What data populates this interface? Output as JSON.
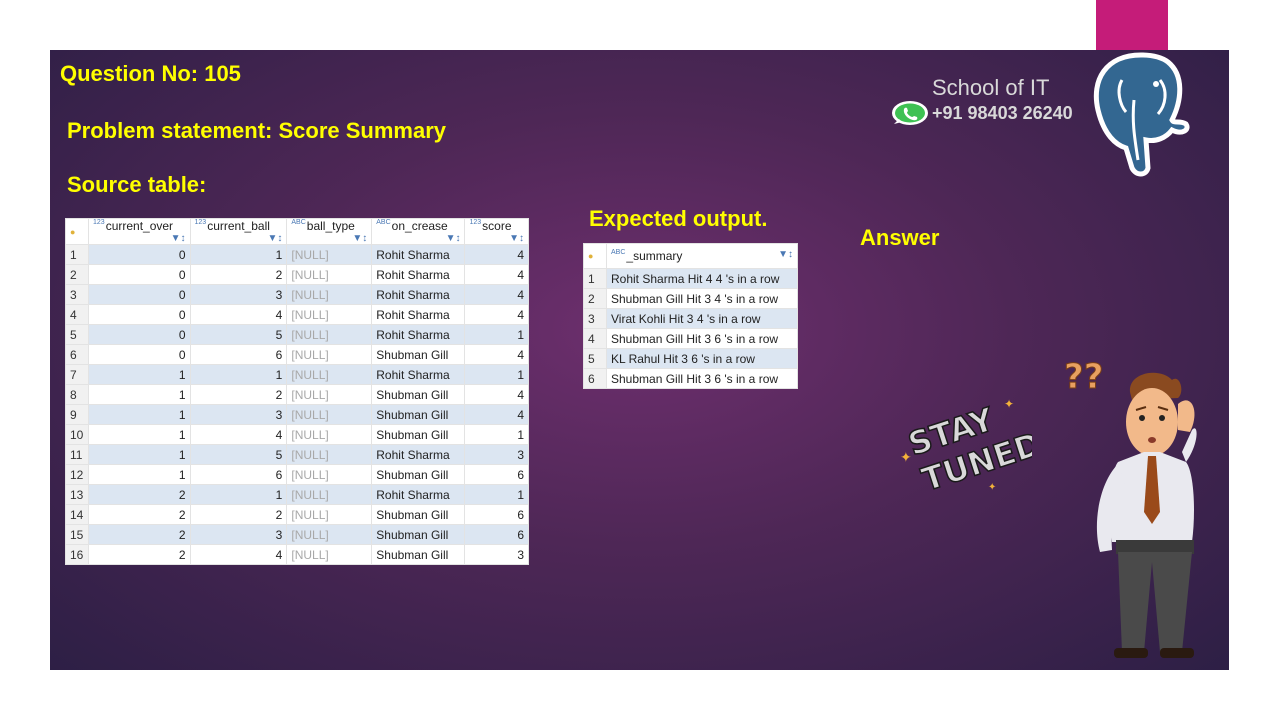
{
  "slide": {
    "question_no": "Question No: 105",
    "problem_statement": "Problem statement: Score Summary",
    "source_table_label": "Source table:",
    "expected_output_label": "Expected output.",
    "answer_label": "Answer"
  },
  "brand": {
    "name": "School of IT",
    "phone": "+91 98403 26240",
    "whatsapp_icon": "whatsapp-icon",
    "logo_icon": "postgresql-elephant-icon"
  },
  "source_table": {
    "columns": [
      {
        "type": "123",
        "name": "current_over"
      },
      {
        "type": "123",
        "name": "current_ball"
      },
      {
        "type": "ABC",
        "name": "ball_type"
      },
      {
        "type": "ABC",
        "name": "on_crease"
      },
      {
        "type": "123",
        "name": "score"
      }
    ],
    "rows": [
      [
        "1",
        "0",
        "1",
        "[NULL]",
        "Rohit Sharma",
        "4"
      ],
      [
        "2",
        "0",
        "2",
        "[NULL]",
        "Rohit Sharma",
        "4"
      ],
      [
        "3",
        "0",
        "3",
        "[NULL]",
        "Rohit Sharma",
        "4"
      ],
      [
        "4",
        "0",
        "4",
        "[NULL]",
        "Rohit Sharma",
        "4"
      ],
      [
        "5",
        "0",
        "5",
        "[NULL]",
        "Rohit Sharma",
        "1"
      ],
      [
        "6",
        "0",
        "6",
        "[NULL]",
        "Shubman Gill",
        "4"
      ],
      [
        "7",
        "1",
        "1",
        "[NULL]",
        "Rohit Sharma",
        "1"
      ],
      [
        "8",
        "1",
        "2",
        "[NULL]",
        "Shubman Gill",
        "4"
      ],
      [
        "9",
        "1",
        "3",
        "[NULL]",
        "Shubman Gill",
        "4"
      ],
      [
        "10",
        "1",
        "4",
        "[NULL]",
        "Shubman Gill",
        "1"
      ],
      [
        "11",
        "1",
        "5",
        "[NULL]",
        "Rohit Sharma",
        "3"
      ],
      [
        "12",
        "1",
        "6",
        "[NULL]",
        "Shubman Gill",
        "6"
      ],
      [
        "13",
        "2",
        "1",
        "[NULL]",
        "Rohit Sharma",
        "1"
      ],
      [
        "14",
        "2",
        "2",
        "[NULL]",
        "Shubman Gill",
        "6"
      ],
      [
        "15",
        "2",
        "3",
        "[NULL]",
        "Shubman Gill",
        "6"
      ],
      [
        "16",
        "2",
        "4",
        "[NULL]",
        "Shubman Gill",
        "3"
      ]
    ]
  },
  "output_table": {
    "columns": [
      {
        "type": "ABC",
        "name": "_summary"
      }
    ],
    "rows": [
      [
        "1",
        "Rohit Sharma Hit  4   4 's in a row"
      ],
      [
        "2",
        "Shubman Gill Hit  3   4 's in a row"
      ],
      [
        "3",
        "Virat Kohli Hit  3   4 's in a row"
      ],
      [
        "4",
        "Shubman Gill Hit  3   6 's in a row"
      ],
      [
        "5",
        "KL Rahul Hit  3   6 's in a row"
      ],
      [
        "6",
        "Shubman Gill Hit  3   6 's in a row"
      ]
    ]
  },
  "sticker": {
    "line1": "STAY",
    "line2": "TUNED"
  },
  "illustration": {
    "question_marks": "??"
  },
  "colors": {
    "accent_yellow": "#ffff00",
    "slide_bg": "#4e2756",
    "logo_strip": "#c51c79",
    "row_stripe": "#dce6f2"
  }
}
